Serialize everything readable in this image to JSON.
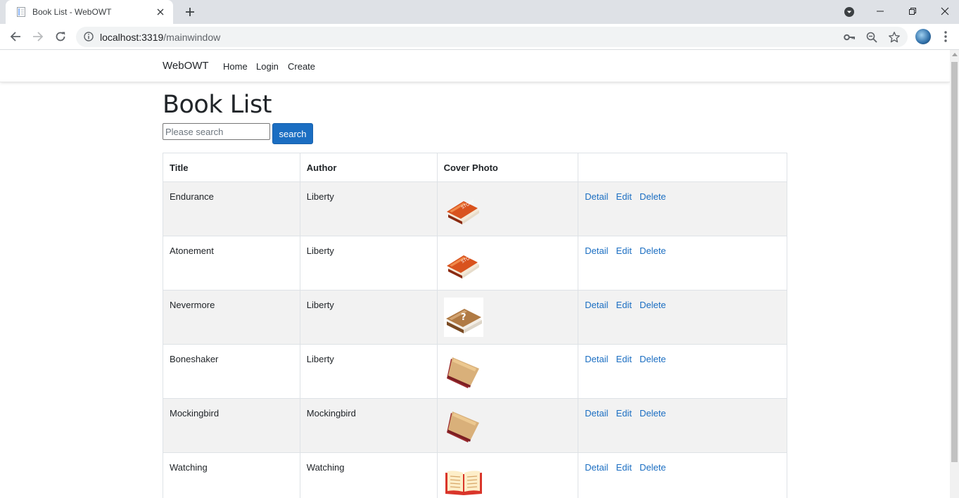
{
  "browser": {
    "tab_title": "Book List - WebOWT",
    "url_host": "localhost:3319",
    "url_path": "/mainwindow"
  },
  "nav": {
    "brand": "WebOWT",
    "links": [
      "Home",
      "Login",
      "Create"
    ]
  },
  "page": {
    "title": "Book List",
    "search_placeholder": "Please search",
    "search_button": "search"
  },
  "table": {
    "headers": [
      "Title",
      "Author",
      "Cover Photo",
      ""
    ],
    "actions": [
      "Detail",
      "Edit",
      "Delete"
    ],
    "rows": [
      {
        "title": "Endurance",
        "author": "Liberty",
        "cover": "red-story-book-icon"
      },
      {
        "title": "Atonement",
        "author": "Liberty",
        "cover": "red-story-book-icon"
      },
      {
        "title": "Nevermore",
        "author": "Liberty",
        "cover": "question-book-icon"
      },
      {
        "title": "Boneshaker",
        "author": "Liberty",
        "cover": "tan-book-icon"
      },
      {
        "title": "Mockingbird",
        "author": "Mockingbird",
        "cover": "tan-book-icon"
      },
      {
        "title": "Watching",
        "author": "Watching",
        "cover": "open-book-icon"
      }
    ]
  },
  "colors": {
    "link": "#1b6ec2",
    "button": "#1b6ec2",
    "stripe": "#f2f2f2"
  }
}
